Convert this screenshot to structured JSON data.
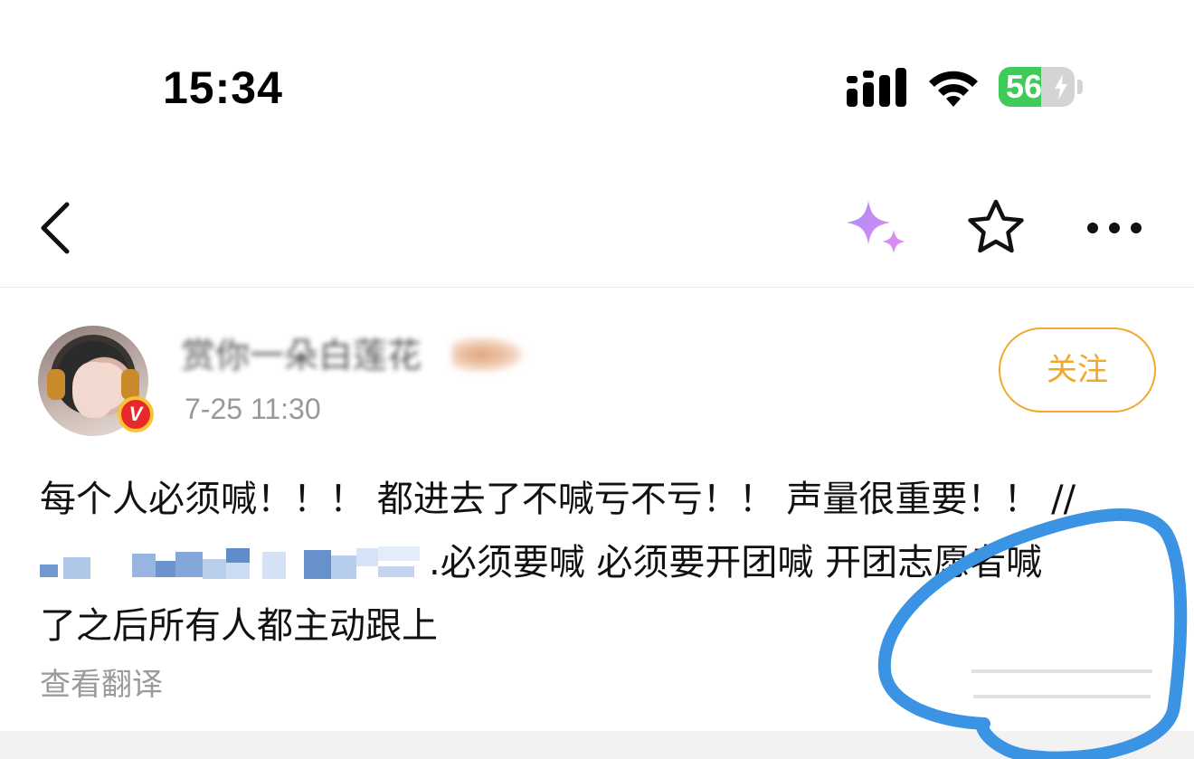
{
  "status_bar": {
    "time": "15:34",
    "battery_percent": "56",
    "battery_level": 0.56,
    "signal_icon": "cellular-signal-icon",
    "wifi_icon": "wifi-icon",
    "battery_icon": "battery-charging-icon"
  },
  "nav": {
    "back_icon": "chevron-left-icon",
    "ai_icon": "sparkle-icon",
    "favorite_icon": "star-outline-icon",
    "more_icon": "more-horizontal-icon",
    "ai_icon_color": "#b47df0"
  },
  "post": {
    "username": "赏你一朵白莲花",
    "timestamp": "7-25 11:30",
    "follow_label": "关注",
    "follow_color": "#f1a82b",
    "verified_badge": "V",
    "content": {
      "line1": "每个人必须喊！！！ 都进去了不喊亏不亏！！ 声量很重要！！ //",
      "line2_tail": ".必须要喊 必须要开团喊 开团志愿者喊",
      "line3": "了之后所有人都主动跟上"
    },
    "translate_label": "查看翻译"
  },
  "annotation": {
    "color": "#3b93e4"
  }
}
